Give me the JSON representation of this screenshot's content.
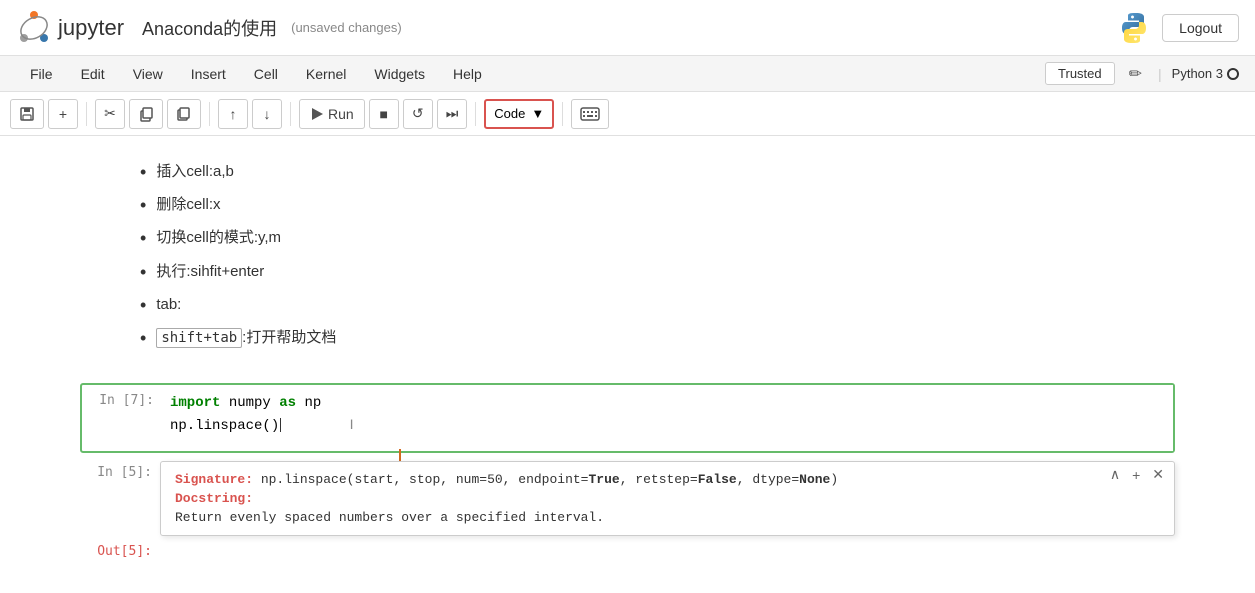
{
  "topbar": {
    "logo_text": "jupyter",
    "title": "Anaconda的使用",
    "unsaved": "(unsaved changes)",
    "logout_label": "Logout"
  },
  "menubar": {
    "items": [
      {
        "label": "File"
      },
      {
        "label": "Edit"
      },
      {
        "label": "View"
      },
      {
        "label": "Insert"
      },
      {
        "label": "Cell"
      },
      {
        "label": "Kernel"
      },
      {
        "label": "Widgets"
      },
      {
        "label": "Help"
      }
    ],
    "trusted_label": "Trusted",
    "kernel_label": "Python 3"
  },
  "toolbar": {
    "save_label": "💾",
    "add_label": "+",
    "cut_label": "✂",
    "copy_label": "⧉",
    "paste_label": "⧉",
    "move_up_label": "↑",
    "move_down_label": "↓",
    "run_label": "Run",
    "stop_label": "■",
    "restart_label": "↺",
    "restart_run_label": "⏭",
    "cell_type": "Code",
    "keyboard_label": "⌨"
  },
  "content": {
    "bullets": [
      {
        "text": "插入cell:a,b"
      },
      {
        "text": "删除cell:x"
      },
      {
        "text": "切换cell的模式:y,m"
      },
      {
        "text": "执行:sihfit+enter"
      },
      {
        "text": "tab:"
      },
      {
        "text": "shift+tab:打开帮助文档",
        "highlight": "shift+tab"
      }
    ],
    "code_cell": {
      "in_label": "In  [7]:",
      "line1": "import numpy as np",
      "line2": "np.linspace()"
    },
    "output_cell": {
      "in_label": "In  [5]:",
      "out_label": "Out[5]:"
    },
    "tooltip": {
      "signature_label": "Signature:",
      "signature_text": " np.linspace(start, stop, num=50, endpoint=True, retstep=False, dtype=None)",
      "sig_bold_parts": [
        "True",
        "False",
        "None"
      ],
      "docstring_label": "Docstring:",
      "docstring_text": "Return evenly spaced numbers over a specified interval."
    }
  }
}
